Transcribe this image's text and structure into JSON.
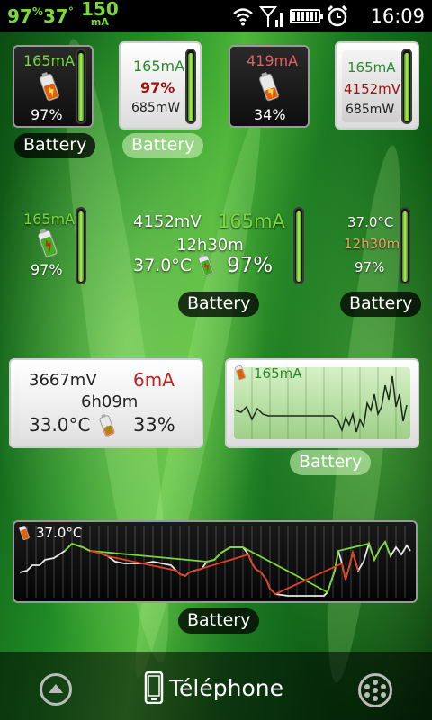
{
  "status_bar": {
    "battery_percent": "97",
    "percent_sign": "%",
    "temperature": "37",
    "degree_sign": "°",
    "current_value": "150",
    "current_unit": "mA",
    "battery_level": 0.97,
    "time": "16:09",
    "icons": [
      "wifi-icon",
      "signal-icon",
      "battery-icon",
      "alarm-clock-icon"
    ]
  },
  "widgets": {
    "w1": {
      "current": "165mA",
      "percent": "97%",
      "label": "Battery",
      "level": 0.97
    },
    "w2": {
      "current": "165mA",
      "percent": "97%",
      "power": "685mW",
      "label": "Battery",
      "level": 0.97
    },
    "w3": {
      "current": "419mA",
      "percent": "34%",
      "level": 0.34
    },
    "w4": {
      "current": "165mA",
      "voltage": "4152mV",
      "power": "685mW",
      "level": 0.97
    },
    "w5": {
      "current": "165mA",
      "percent": "97%",
      "level": 0.97
    },
    "w6": {
      "voltage": "4152mV",
      "current": "165mA",
      "time": "12h30m",
      "temperature": "37.0°C",
      "percent": "97%",
      "label": "Battery",
      "level": 0.97
    },
    "w7": {
      "temperature": "37.0°C",
      "time": "12h30m",
      "percent": "97%",
      "label": "Battery",
      "level": 0.97
    },
    "w8": {
      "voltage": "3667mV",
      "current": "6mA",
      "time": "6h09m",
      "temperature": "33.0°C",
      "percent": "33%"
    },
    "w9": {
      "current": "165mA",
      "label": "Battery"
    },
    "w10": {
      "temperature": "37.0°C",
      "label": "Battery"
    }
  },
  "dock": {
    "center_label": "Téléphone"
  },
  "colors": {
    "green_text": "#7bd83a",
    "red_text": "#c02020",
    "orange_text": "#f0a060",
    "dark_green_text": "#2a8a2a"
  }
}
